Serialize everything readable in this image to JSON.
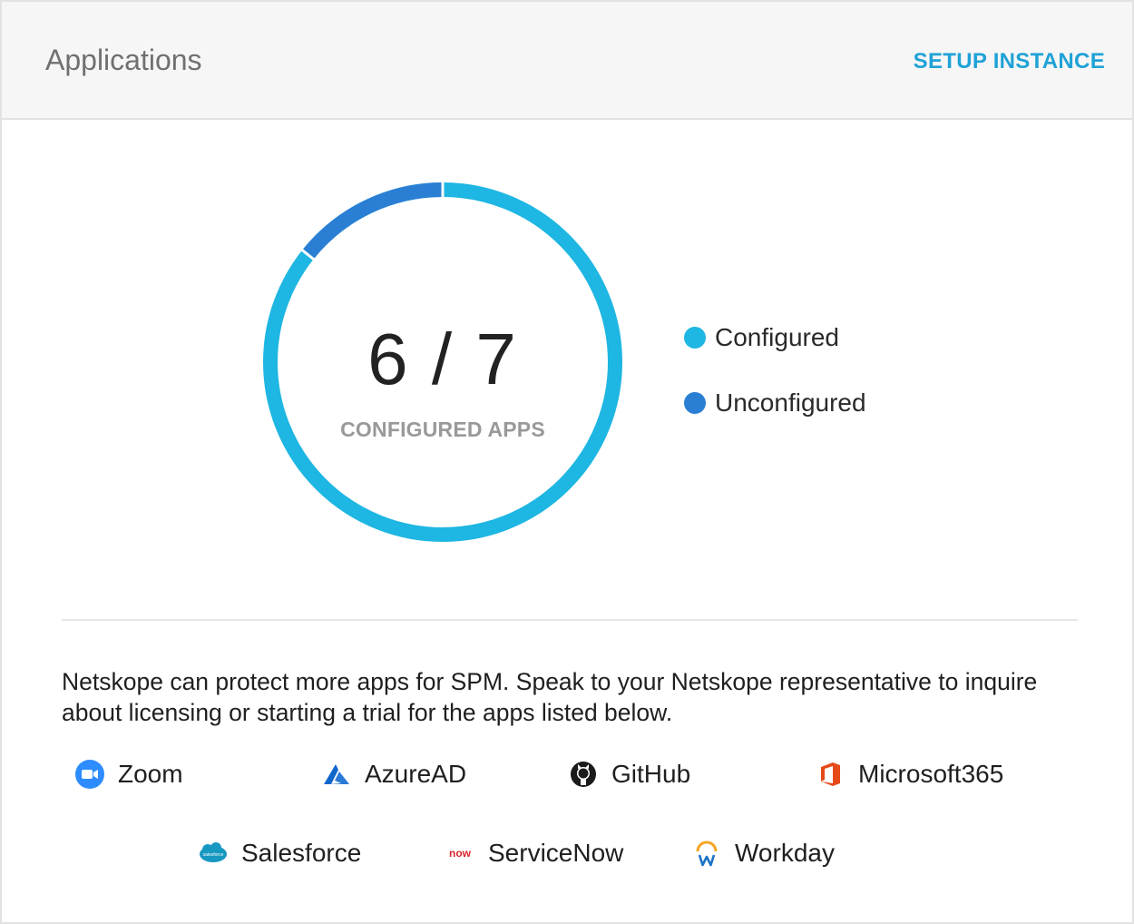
{
  "header": {
    "title": "Applications",
    "action_label": "SETUP INSTANCE"
  },
  "summary": {
    "configured": 6,
    "total": 7,
    "value_text": "6 / 7",
    "caption": "CONFIGURED APPS"
  },
  "legend": [
    {
      "label": "Configured",
      "color": "#1eb6e2"
    },
    {
      "label": "Unconfigured",
      "color": "#2a7fd4"
    }
  ],
  "message": "Netskope can protect more apps for SPM. Speak to your Netskope representative to inquire about licensing or starting a trial for the apps listed below.",
  "apps": [
    {
      "label": "Zoom",
      "icon": "zoom-icon"
    },
    {
      "label": "AzureAD",
      "icon": "azure-icon"
    },
    {
      "label": "GitHub",
      "icon": "github-icon"
    },
    {
      "label": "Microsoft365",
      "icon": "microsoft365-icon"
    },
    {
      "label": "Salesforce",
      "icon": "salesforce-icon"
    },
    {
      "label": "ServiceNow",
      "icon": "servicenow-icon"
    },
    {
      "label": "Workday",
      "icon": "workday-icon"
    }
  ],
  "icon_text": {
    "salesforce": "salesforce",
    "servicenow": "now"
  }
}
